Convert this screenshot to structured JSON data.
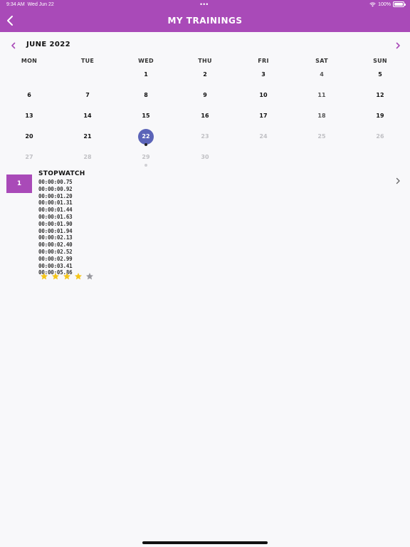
{
  "status_bar": {
    "time": "9:34 AM",
    "date": "Wed Jun 22",
    "dots": "•••",
    "battery": "100%"
  },
  "header": {
    "title": "MY TRAININGS"
  },
  "calendar": {
    "month_label": "JUNE 2022",
    "weekdays": [
      "MON",
      "TUE",
      "WED",
      "THU",
      "FRI",
      "SAT",
      "SUN"
    ],
    "selected_day": "22",
    "weeks": [
      [
        null,
        null,
        "1",
        "2",
        "3",
        "4",
        "5"
      ],
      [
        "6",
        "7",
        "8",
        "9",
        "10",
        "11",
        "12"
      ],
      [
        "13",
        "14",
        "15",
        "16",
        "17",
        "18",
        "19"
      ],
      [
        "20",
        "21",
        "22",
        "23",
        "24",
        "25",
        "26"
      ],
      [
        "27",
        "28",
        "29",
        "30",
        null,
        null,
        null
      ]
    ],
    "muted_days": [
      "23",
      "24",
      "25",
      "26",
      "27",
      "28",
      "29",
      "30"
    ],
    "greyed_weekend_days": [
      "4",
      "11",
      "18"
    ],
    "event_days": [
      "22",
      "29"
    ]
  },
  "training": {
    "index": "1",
    "title": "STOPWATCH",
    "times": [
      "00:00:00.75",
      "00:00:00.92",
      "00:00:01.20",
      "00:00:01.31",
      "00:00:01.44",
      "00:00:01.63",
      "00:00:01.90",
      "00:00:01.94",
      "00:00:02.13",
      "00:00:02.40",
      "00:00:02.52",
      "00:00:02.99",
      "00:00:03.41",
      "00:00:05.86"
    ],
    "rating": 4,
    "rating_max": 5
  },
  "colors": {
    "accent": "#a94ab8",
    "selected_day": "#5b64b8",
    "star_filled": "#f5c518",
    "star_empty": "#9a9aa0"
  },
  "icons": {
    "back": "chevron-left-icon",
    "prev_month": "chevron-left-icon",
    "next_month": "chevron-right-icon",
    "row_disclosure": "chevron-right-icon",
    "star": "star-icon",
    "wifi": "wifi-icon",
    "battery": "battery-icon"
  }
}
